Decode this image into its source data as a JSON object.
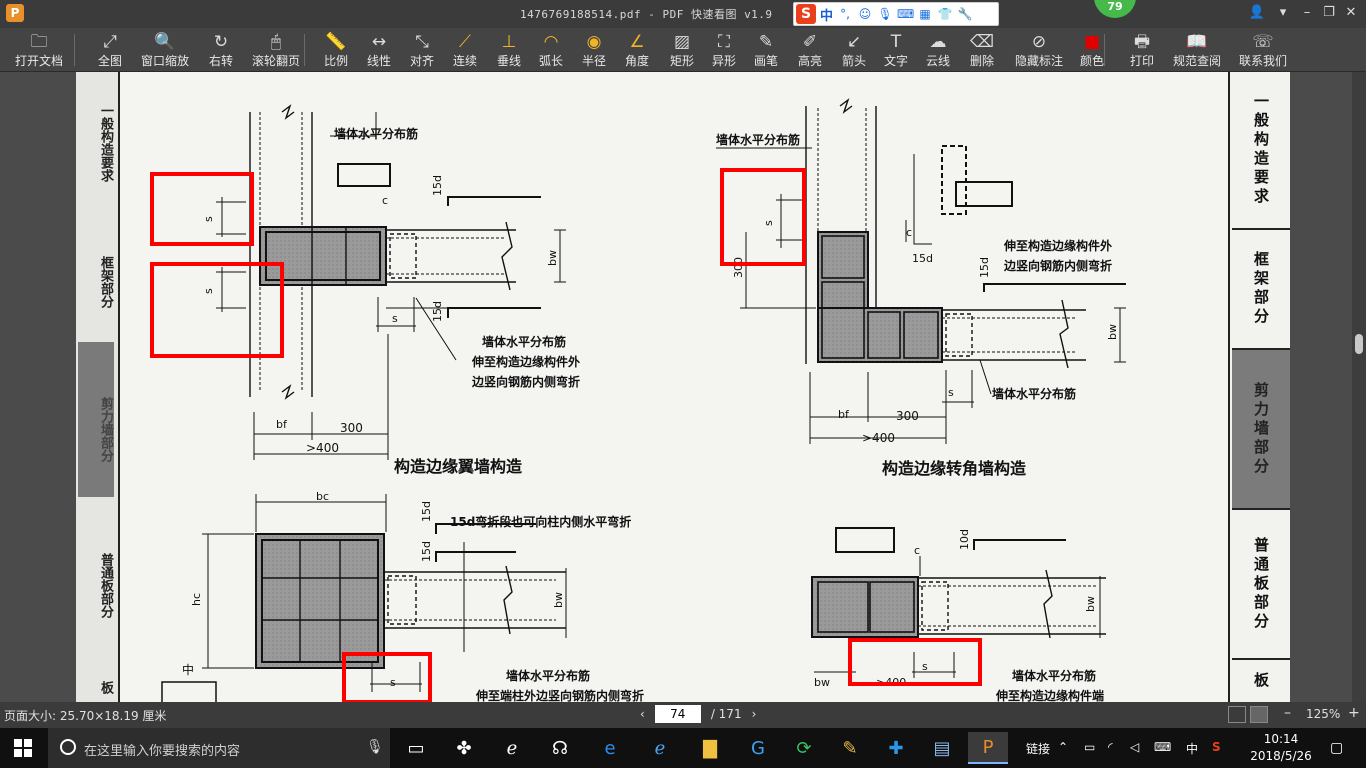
{
  "window": {
    "title": "1476769188514.pdf - PDF 快速看图 v1.9",
    "app_logo_letter": "P",
    "badge": "79",
    "ime": {
      "logo": "S",
      "mode": "中",
      "punct": "°,"
    }
  },
  "toolbar": {
    "items": [
      {
        "id": "open",
        "label": "打开文档",
        "icon": "folder-icon",
        "glyph": "🗀"
      },
      {
        "id": "fit",
        "label": "全图",
        "icon": "fullscreen-icon",
        "glyph": "⤢"
      },
      {
        "id": "window-zoom",
        "label": "窗口缩放",
        "icon": "magnifier-icon",
        "glyph": "🔍"
      },
      {
        "id": "rotate",
        "label": "右转",
        "icon": "rotate-icon",
        "glyph": "↻"
      },
      {
        "id": "scroll-page",
        "label": "滚轮翻页",
        "icon": "mouse-icon",
        "glyph": "🖱"
      },
      {
        "id": "scale",
        "label": "比例",
        "icon": "ruler-icon",
        "glyph": "📏"
      },
      {
        "id": "linear",
        "label": "线性",
        "icon": "linear-dim-icon",
        "glyph": "↔"
      },
      {
        "id": "aligned",
        "label": "对齐",
        "icon": "aligned-dim-icon",
        "glyph": "⤡"
      },
      {
        "id": "continuous",
        "label": "连续",
        "icon": "continuous-dim-icon",
        "glyph": "⟋"
      },
      {
        "id": "perpendicular",
        "label": "垂线",
        "icon": "perpendicular-icon",
        "glyph": "⊥"
      },
      {
        "id": "arc-length",
        "label": "弧长",
        "icon": "arc-icon",
        "glyph": "◠"
      },
      {
        "id": "radius",
        "label": "半径",
        "icon": "radius-icon",
        "glyph": "◉"
      },
      {
        "id": "angle",
        "label": "角度",
        "icon": "angle-icon",
        "glyph": "∠"
      },
      {
        "id": "rect",
        "label": "矩形",
        "icon": "rect-area-icon",
        "glyph": "▨"
      },
      {
        "id": "poly",
        "label": "异形",
        "icon": "poly-area-icon",
        "glyph": "⛶"
      },
      {
        "id": "pen",
        "label": "画笔",
        "icon": "pen-icon",
        "glyph": "✎"
      },
      {
        "id": "highlight",
        "label": "高亮",
        "icon": "highlighter-icon",
        "glyph": "✐"
      },
      {
        "id": "arrow",
        "label": "箭头",
        "icon": "arrow-icon",
        "glyph": "↙"
      },
      {
        "id": "text",
        "label": "文字",
        "icon": "text-icon",
        "glyph": "T"
      },
      {
        "id": "cloud",
        "label": "云线",
        "icon": "cloud-icon",
        "glyph": "☁"
      },
      {
        "id": "delete",
        "label": "删除",
        "icon": "eraser-icon",
        "glyph": "⌫"
      },
      {
        "id": "hide-marks",
        "label": "隐藏标注",
        "icon": "eye-off-icon",
        "glyph": "⊘"
      },
      {
        "id": "color",
        "label": "颜色",
        "icon": "color-swatch-icon",
        "glyph": "■"
      },
      {
        "id": "print",
        "label": "打印",
        "icon": "printer-icon",
        "glyph": "🖶"
      },
      {
        "id": "spec",
        "label": "规范查阅",
        "icon": "book-icon",
        "glyph": "📖"
      },
      {
        "id": "contact",
        "label": "联系我们",
        "icon": "headset-icon",
        "glyph": "☏"
      }
    ],
    "color_value": "#e00000"
  },
  "drawing": {
    "left_tabs": [
      "一般构造要求",
      "框架部分",
      "剪力墙部分",
      "普通板部分",
      "板"
    ],
    "right_tabs": [
      "一般构造要求",
      "框架部分",
      "剪力墙部分",
      "普通板部分",
      "板"
    ],
    "labels": {
      "wall_horiz_rebar": "墙体水平分布筋",
      "extend_note_1": "伸至构造边缘构件外",
      "extend_note_2": "边竖向钢筋内侧弯折",
      "flange_title": "构造边缘翼墙构造",
      "corner_title": "构造边缘转角墙构造",
      "col_note": "15d弯折段也可向柱内侧水平弯折",
      "col_note2": "伸至端柱外边竖向钢筋内侧弯折",
      "col_note3": "伸至构造边缘构件端",
      "s": "s",
      "c": "c",
      "d15": "15d",
      "d10": "10d",
      "bw": "bw",
      "bf": "bf",
      "bc": "bc",
      "hc": "hc",
      "d300": "300",
      "ge400": ">400",
      "ge400b": ">400",
      "zhong": "中"
    },
    "annotation_color": "#ff0000"
  },
  "status": {
    "page_size": "页面大小: 25.70×18.19 厘米",
    "current_page": "74",
    "total_pages": "/ 171",
    "zoom": "125%"
  },
  "taskbar": {
    "search_placeholder": "在这里输入你要搜索的内容",
    "tray_link": "链接",
    "ime": "中",
    "time": "10:14",
    "date": "2018/5/26"
  }
}
